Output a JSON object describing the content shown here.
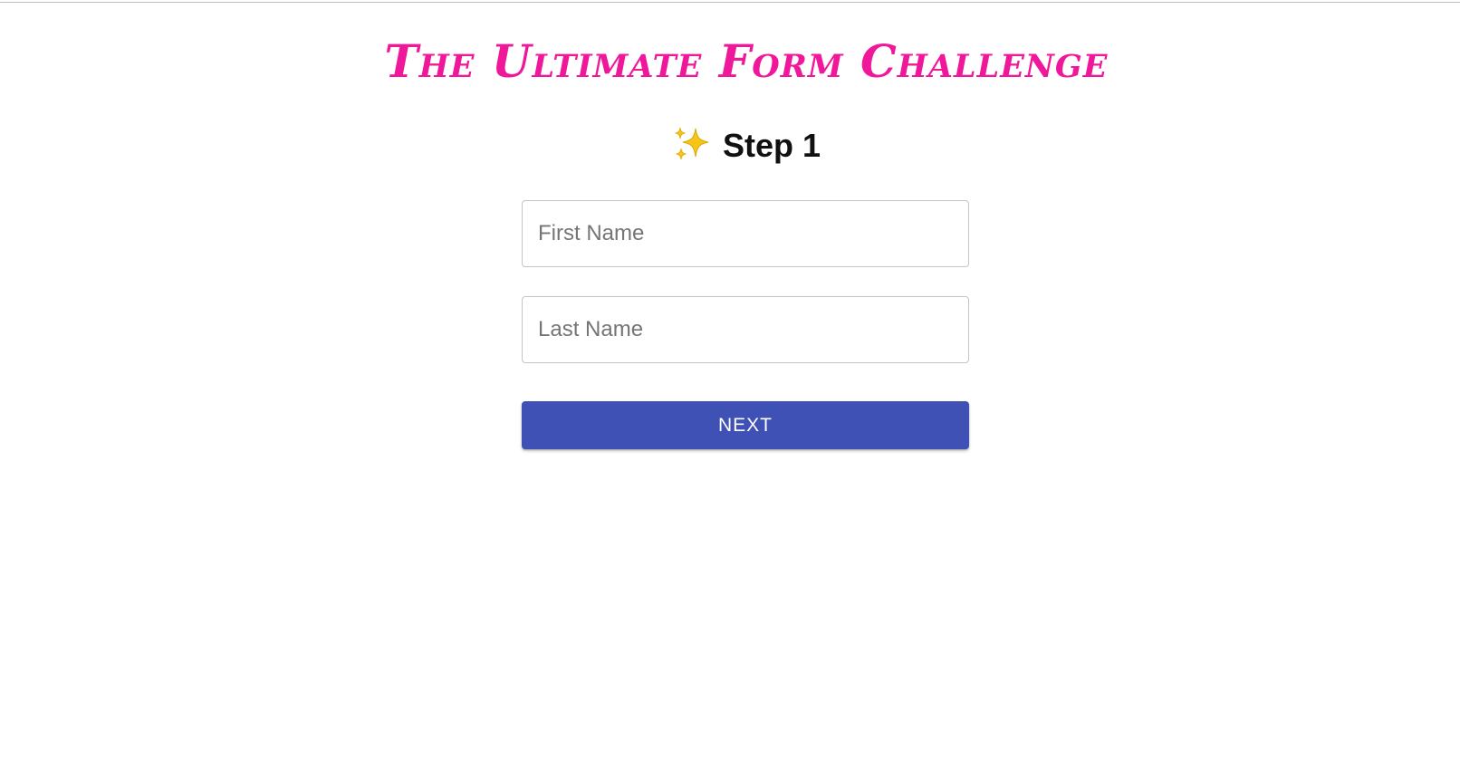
{
  "colors": {
    "title": "#f0189a",
    "button": "#3f51b5",
    "button_text": "#ffffff"
  },
  "header": {
    "title": "The Ultimate Form Challenge"
  },
  "step": {
    "icon": "sparkles-icon",
    "label": "Step 1"
  },
  "form": {
    "first_name": {
      "value": "",
      "placeholder": "First Name"
    },
    "last_name": {
      "value": "",
      "placeholder": "Last Name"
    },
    "next_label": "NEXT"
  }
}
